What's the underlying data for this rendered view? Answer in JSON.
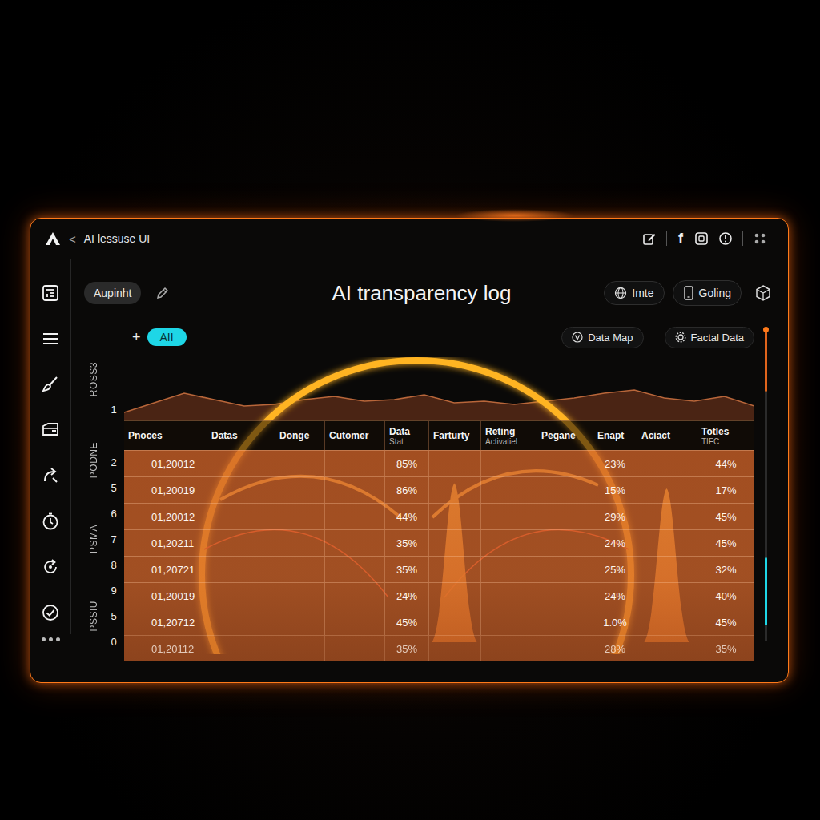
{
  "window": {
    "title": "AI lessuse UI",
    "back": "<"
  },
  "header_icons": {
    "social": "f"
  },
  "toolbar": {
    "chip": "Aupinht",
    "title": "AI transparency log",
    "buttons": [
      "Imte",
      "Goling"
    ]
  },
  "filters": {
    "add": "+",
    "chips": [
      {
        "label": "AII",
        "selected": true
      }
    ],
    "links": [
      "Data Map",
      "Factal Data"
    ]
  },
  "chart": {
    "axis_label": "ROSS3",
    "tick": "1",
    "area": [
      10,
      22,
      34,
      26,
      18,
      20,
      26,
      30,
      24,
      26,
      32,
      22,
      24,
      20,
      24,
      28,
      34,
      38,
      28,
      24,
      30,
      18
    ],
    "peaks": [
      0,
      0,
      0,
      0,
      0,
      62,
      0,
      0,
      0,
      60,
      0
    ]
  },
  "table": {
    "groups": [
      {
        "label": "PODNE",
        "rows": 3
      },
      {
        "label": "PSMA",
        "rows": 3
      },
      {
        "label": "PSSIU",
        "rows": 3
      }
    ],
    "columns": [
      {
        "label": "Pnoces",
        "sub": ""
      },
      {
        "label": "Datas",
        "sub": ""
      },
      {
        "label": "Donge",
        "sub": ""
      },
      {
        "label": "Cutomer",
        "sub": ""
      },
      {
        "label": "Data",
        "sub": "Stat"
      },
      {
        "label": "Farturty",
        "sub": ""
      },
      {
        "label": "Reting",
        "sub": "Activatiel"
      },
      {
        "label": "Pegane",
        "sub": ""
      },
      {
        "label": "Enapt",
        "sub": ""
      },
      {
        "label": "Aciact",
        "sub": ""
      },
      {
        "label": "Totles",
        "sub": "TIFC"
      }
    ],
    "rows": [
      {
        "index": "2",
        "cells": [
          "01,20012",
          "",
          "",
          "",
          "85%",
          "",
          "",
          "",
          "23%",
          "",
          "44%"
        ]
      },
      {
        "index": "5",
        "cells": [
          "01,20019",
          "",
          "",
          "",
          "86%",
          "",
          "",
          "",
          "15%",
          "",
          "17%"
        ]
      },
      {
        "index": "6",
        "cells": [
          "01,20012",
          "",
          "",
          "",
          "44%",
          "",
          "",
          "",
          "29%",
          "",
          "45%"
        ]
      },
      {
        "index": "7",
        "cells": [
          "01,20211",
          "",
          "",
          "",
          "35%",
          "",
          "",
          "",
          "24%",
          "",
          "45%"
        ]
      },
      {
        "index": "8",
        "cells": [
          "01,20721",
          "",
          "",
          "",
          "35%",
          "",
          "",
          "",
          "25%",
          "",
          "32%"
        ]
      },
      {
        "index": "9",
        "cells": [
          "01,20019",
          "",
          "",
          "",
          "24%",
          "",
          "",
          "",
          "24%",
          "",
          "40%"
        ]
      },
      {
        "index": "5",
        "cells": [
          "01,20712",
          "",
          "",
          "",
          "45%",
          "",
          "",
          "",
          "1.0%",
          "",
          "45%"
        ]
      },
      {
        "index": "0",
        "cells": [
          "01,20112",
          "",
          "",
          "",
          "35%",
          "",
          "",
          "",
          "28%",
          "",
          "35%"
        ]
      }
    ]
  },
  "scrollbar": {
    "top_level": 0.2,
    "thumb_start": 0.73,
    "thumb_level": 0.22
  }
}
